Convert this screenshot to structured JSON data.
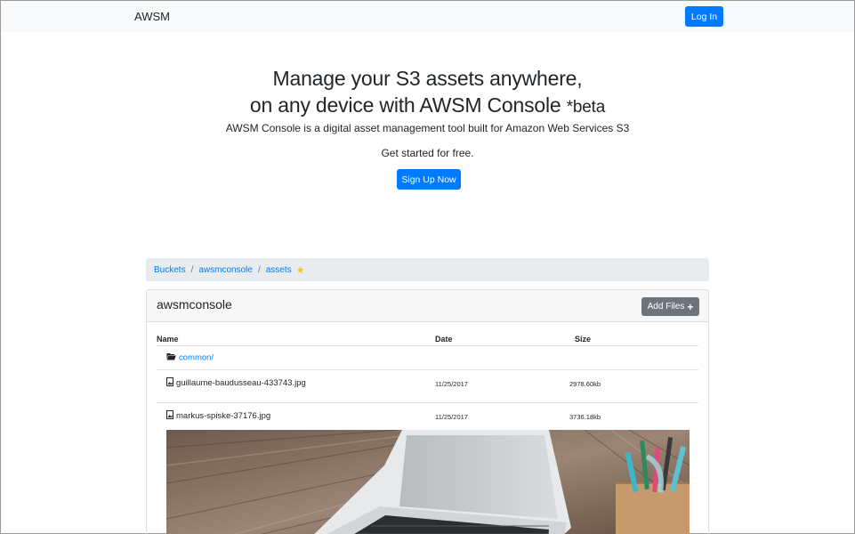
{
  "nav": {
    "brand": "AWSM",
    "login_label": "Log In"
  },
  "hero": {
    "title_line1": "Manage your S3 assets anywhere,",
    "title_line2": "on any device with AWSM Console",
    "title_beta": "*beta",
    "subtitle": "AWSM Console is a digital asset management tool built for Amazon Web Services S3",
    "get_started": "Get started for free.",
    "signup_label": "Sign Up Now"
  },
  "breadcrumb": {
    "items": [
      "Buckets",
      "awsmconsole",
      "assets"
    ],
    "separator": "/"
  },
  "bucket": {
    "title": "awsmconsole",
    "add_files_label": "Add Files",
    "add_files_glyph": "+",
    "columns": [
      "Name",
      "Date",
      "Size"
    ],
    "rows": [
      {
        "type": "folder",
        "name": "common/",
        "date": "",
        "size": ""
      },
      {
        "type": "image",
        "name": "guillaume-baudusseau-433743.jpg",
        "date": "11/25/2017",
        "size": "2978.60kb"
      },
      {
        "type": "image",
        "name": "markus-spiske-37176.jpg",
        "date": "11/25/2017",
        "size": "3736.18kb"
      }
    ]
  },
  "colors": {
    "primary": "#007bff",
    "secondary": "#6c757d",
    "star": "#f5c518",
    "navbar_bg": "#f8f9fa"
  }
}
